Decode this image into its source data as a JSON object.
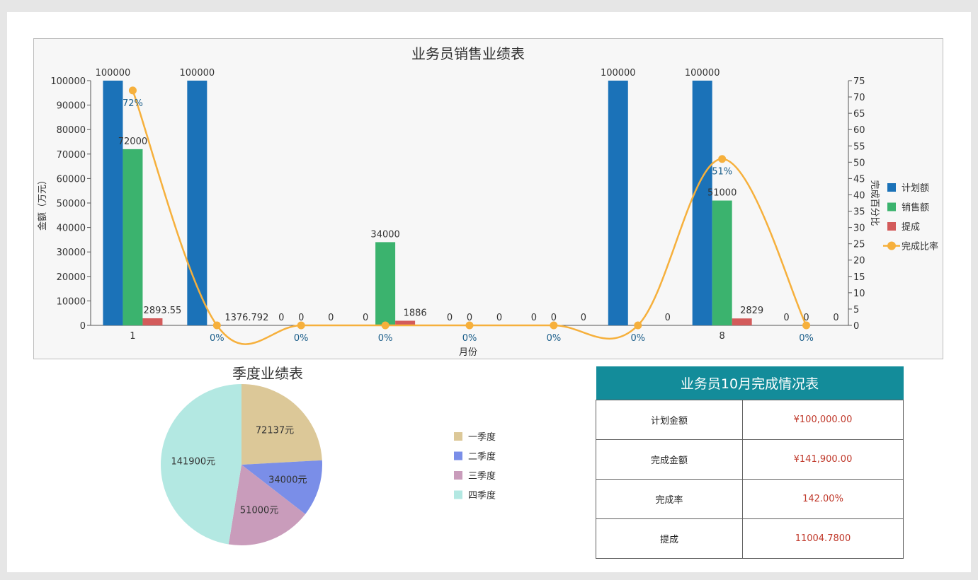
{
  "bar_chart": {
    "title": "业务员销售业绩表",
    "xlabel": "月份",
    "ylabel_left": "金额（万元）",
    "ylabel_right": "完成百分比",
    "legend": [
      "计划额",
      "销售额",
      "提成",
      "完成比率"
    ]
  },
  "pie_chart": {
    "title": "季度业绩表",
    "legend": [
      "一季度",
      "二季度",
      "三季度",
      "四季度"
    ]
  },
  "report": {
    "title": "业务员10月完成情况表",
    "rows": [
      {
        "label": "计划金额",
        "value": "¥100,000.00"
      },
      {
        "label": "完成金额",
        "value": "¥141,900.00"
      },
      {
        "label": "完成率",
        "value": "142.00%"
      },
      {
        "label": "提成",
        "value": "11004.7800"
      }
    ]
  },
  "chart_data": [
    {
      "type": "bar",
      "title": "业务员销售业绩表",
      "xlabel": "月份",
      "ylabel": "金额（万元）",
      "y2label": "完成百分比",
      "categories": [
        "1",
        "",
        "",
        "",
        "",
        "",
        "",
        "8",
        ""
      ],
      "ylim": [
        0,
        100000
      ],
      "y2lim": [
        0,
        75
      ],
      "grid": false,
      "legend_position": "right",
      "series": [
        {
          "name": "计划额",
          "type": "bar",
          "color": "#1b72b8",
          "values": [
            100000,
            100000,
            0,
            0,
            0,
            0,
            100000,
            100000,
            0
          ],
          "labels": [
            "100000",
            "100000",
            "0",
            "0",
            "0",
            "0",
            "100000",
            "100000",
            "0"
          ]
        },
        {
          "name": "销售额",
          "type": "bar",
          "color": "#3bb36e",
          "values": [
            72000,
            0,
            0,
            34000,
            0,
            0,
            0,
            51000,
            0
          ],
          "labels": [
            "72000",
            "",
            "0",
            "34000",
            "0",
            "0",
            "",
            "51000",
            "0"
          ]
        },
        {
          "name": "提成",
          "type": "bar",
          "color": "#d35b5b",
          "values": [
            2893.55,
            0,
            0,
            1886,
            0,
            0,
            0,
            2829,
            0
          ],
          "labels": [
            "2893.55",
            "1376.792",
            "0",
            "1886",
            "0",
            "0",
            "0",
            "2829",
            "0"
          ]
        },
        {
          "name": "完成比率",
          "type": "line",
          "axis": "right",
          "color": "#f6b03c",
          "values": [
            72,
            0,
            0,
            0,
            0,
            0,
            0,
            51,
            0
          ],
          "labels": [
            "72%",
            "0%",
            "0%",
            "0%",
            "0%",
            "0%",
            "0%",
            "51%",
            "0%"
          ]
        }
      ]
    },
    {
      "type": "pie",
      "title": "季度业绩表",
      "legend_position": "right",
      "slices": [
        {
          "name": "一季度",
          "value": 72137,
          "label": "72137元",
          "color": "#dcc898"
        },
        {
          "name": "二季度",
          "value": 34000,
          "label": "34000元",
          "color": "#7a8ee8"
        },
        {
          "name": "三季度",
          "value": 51000,
          "label": "51000元",
          "color": "#c99cbb"
        },
        {
          "name": "四季度",
          "value": 141900,
          "label": "141900元",
          "color": "#b3e8e2"
        }
      ]
    }
  ]
}
